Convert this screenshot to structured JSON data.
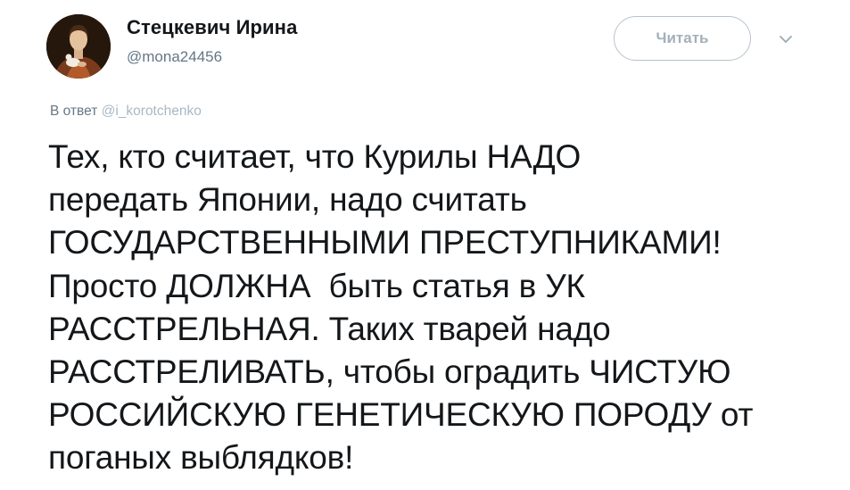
{
  "author": {
    "name": "Стецкевич Ирина",
    "handle": "@mona24456",
    "avatar_icon": "portrait-avatar"
  },
  "follow_button": {
    "label": "Читать"
  },
  "menu": {
    "icon": "chevron-down-icon"
  },
  "reply": {
    "prefix": "В ответ",
    "mention": "@i_korotchenko"
  },
  "tweet": {
    "lines": [
      "Тех, кто считает, что Курилы НАДО",
      "передать Японии, надо считать",
      "ГОСУДАРСТВЕННЫМИ ПРЕСТУПНИКАМИ!",
      "Просто ДОЛЖНА  быть статья в УК",
      "РАССТРЕЛЬНАЯ. Таких тварей надо",
      "РАССТРЕЛИВАТЬ, чтобы оградить ЧИСТУЮ",
      "РОССИЙСКУЮ ГЕНЕТИЧЕСКУЮ ПОРОДУ от",
      "поганых выблядков!"
    ]
  },
  "colors": {
    "text": "#14171a",
    "secondary": "#657786",
    "mention": "#a8b8c4",
    "button_border": "#b8c3cc"
  }
}
